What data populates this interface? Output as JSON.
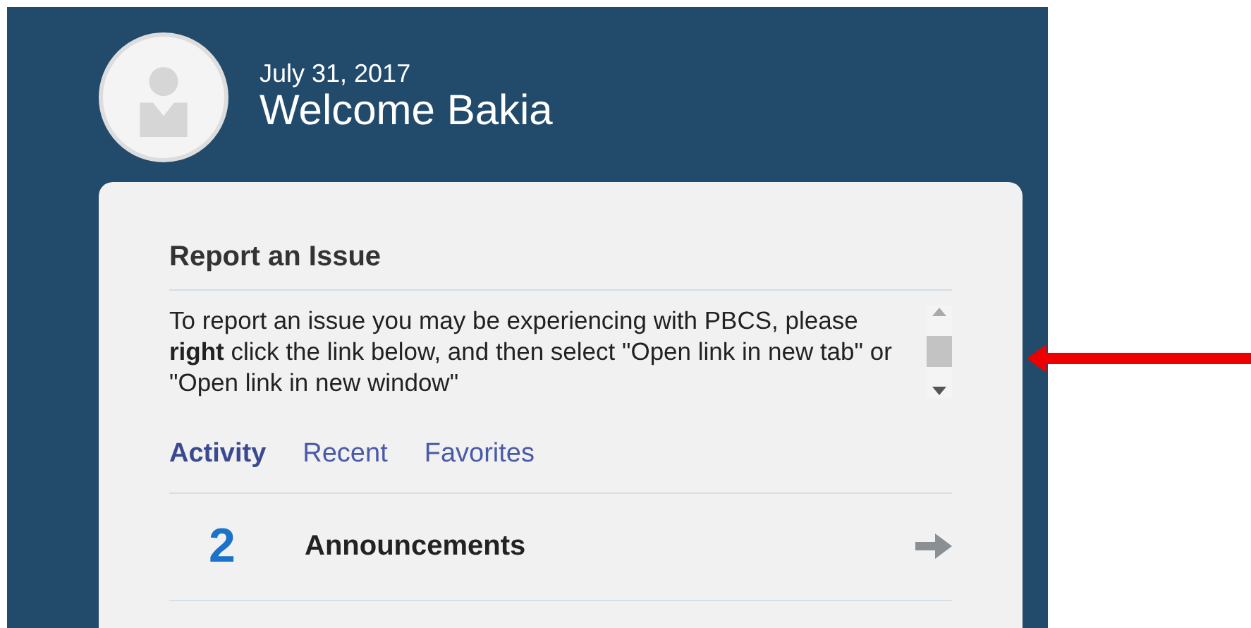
{
  "header": {
    "date": "July 31, 2017",
    "welcome": "Welcome Bakia"
  },
  "report": {
    "title": "Report an Issue",
    "text": "To report an issue you may be experiencing with PBCS, please **right** click the link below, and then select \"Open link in new tab\" or \"Open link in new window\""
  },
  "tabs": [
    {
      "label": "Activity",
      "selected": true
    },
    {
      "label": "Recent",
      "selected": false
    },
    {
      "label": "Favorites",
      "selected": false
    }
  ],
  "activity": [
    {
      "count": "2",
      "label": "Announcements"
    }
  ]
}
